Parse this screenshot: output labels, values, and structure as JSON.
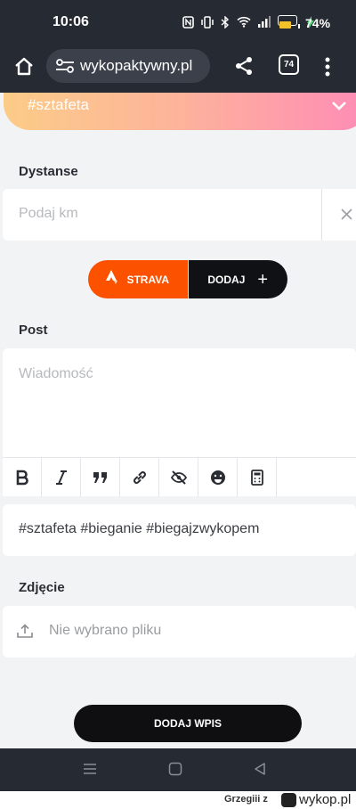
{
  "status_bar": {
    "time": "10:06",
    "battery_percent": "74%",
    "battery_level": 0.74
  },
  "browser": {
    "url": "wykopaktywny.pl",
    "tab_count": "74"
  },
  "form": {
    "team_value": "#sztafeta",
    "distances_label": "Dystanse",
    "distance_placeholder": "Podaj km",
    "strava_label": "STRAVA",
    "add_label": "DODAJ",
    "post_label": "Post",
    "message_placeholder": "Wiadomość",
    "tags_value": "#sztafeta #bieganie #biegajzwykopem",
    "photo_label": "Zdjęcie",
    "photo_status": "Nie wybrano pliku",
    "submit_label": "DODAJ WPIS"
  },
  "editor_tools": [
    "bold-icon",
    "italic-icon",
    "quote-icon",
    "link-icon",
    "spoiler-icon",
    "emoji-icon",
    "calculator-icon"
  ],
  "footer": {
    "username": "Grzegiii",
    "by": "z",
    "brand": "wykop.pl"
  },
  "colors": {
    "strava": "#fc5200",
    "dark_button": "#101114",
    "gradient_start": "#fccc87",
    "gradient_end": "#fe8cb6"
  }
}
